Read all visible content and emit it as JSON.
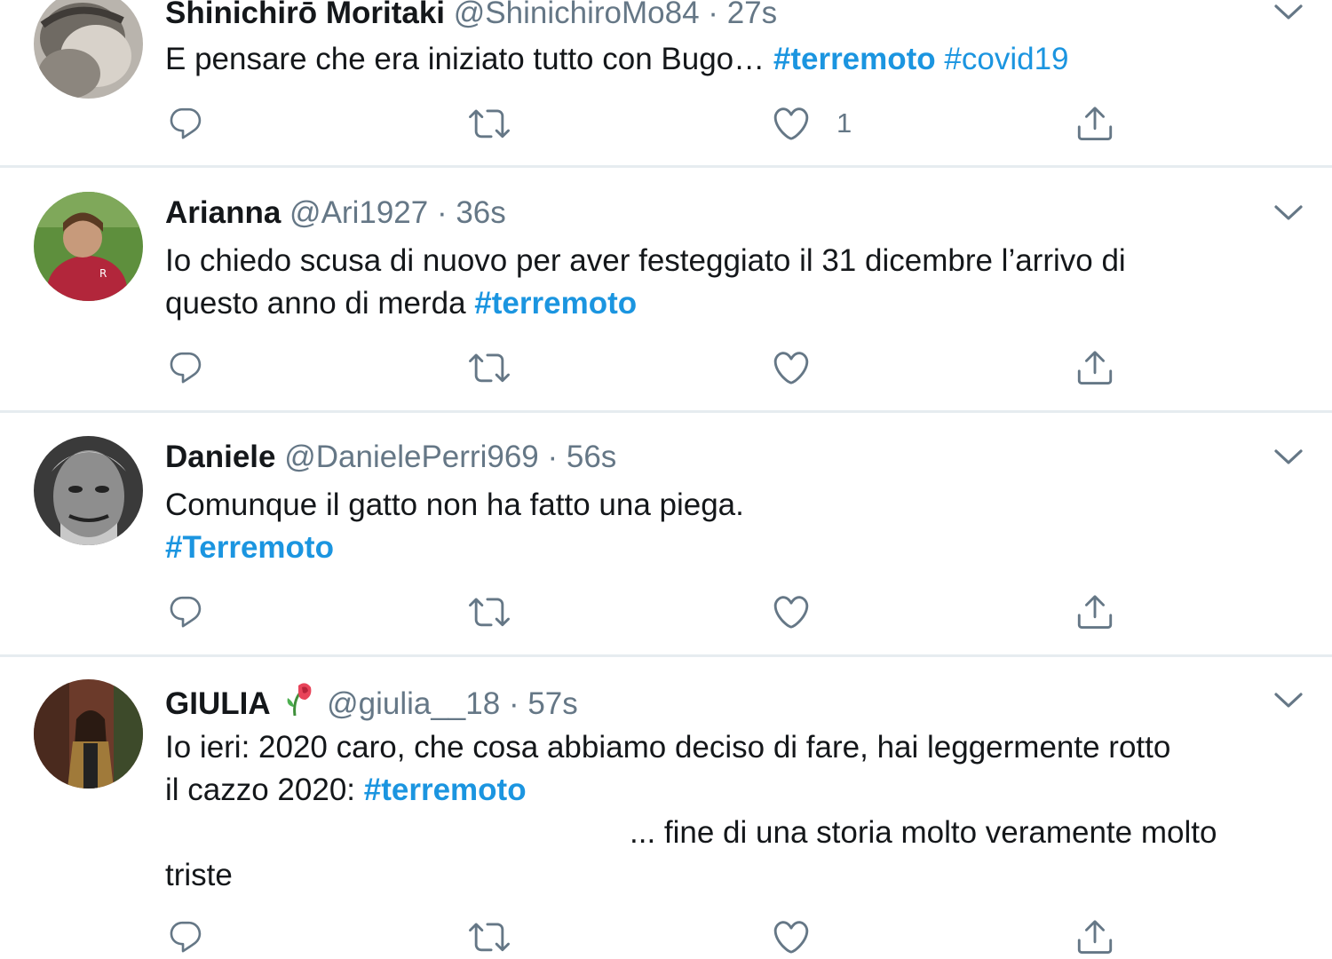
{
  "tweets": [
    {
      "name": "Shinichirō Moritaki",
      "handle": "@ShinichiroMo84",
      "separator": "·",
      "time": "27s",
      "text": "E pensare che era iniziato tutto con Bugo… ",
      "hashtags": [
        "#terremoto",
        "#covid19"
      ],
      "like_count": "1"
    },
    {
      "name": "Arianna",
      "handle": "@Ari1927",
      "separator": "·",
      "time": "36s",
      "text_line1": "Io chiedo scusa di nuovo per aver festeggiato il 31 dicembre l’arrivo di",
      "text_line2": "questo anno di merda ",
      "hashtag": "#terremoto"
    },
    {
      "name": "Daniele",
      "handle": "@DanielePerri969",
      "separator": "·",
      "time": "56s",
      "text_line1": "Comunque il gatto non ha fatto una piega.",
      "hashtag": "#Terremoto"
    },
    {
      "name": "GIULIA",
      "name_emoji": "wilted-rose-icon",
      "handle": "@giulia__18",
      "separator": "·",
      "time": "57s",
      "text_line1": "Io ieri: 2020 caro, che cosa abbiamo deciso di fare, hai leggermente rotto",
      "text_line2": "il cazzo 2020: ",
      "hashtag": "#terremoto",
      "text_line3": "... fine di una storia molto veramente molto",
      "text_line4": "triste"
    }
  ],
  "icons": {
    "reply": "reply-icon",
    "retweet": "retweet-icon",
    "like": "like-icon",
    "share": "share-icon",
    "caret": "chevron-down-icon"
  },
  "colors": {
    "hashtag": "#1b95e0",
    "secondary_text": "#657786",
    "primary_text": "#14171a",
    "divider": "#e6ecf0",
    "icon": "#657786"
  }
}
